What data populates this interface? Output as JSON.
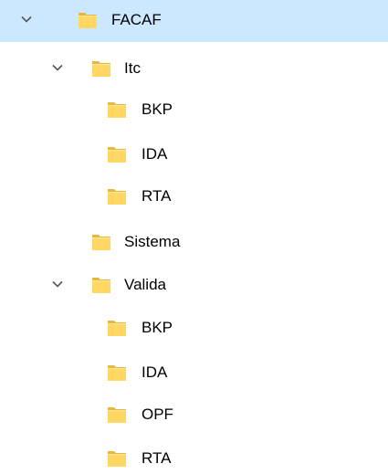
{
  "tree": {
    "nodes": [
      {
        "label": "FACAF",
        "level": 0,
        "expanded": true,
        "selected": true
      },
      {
        "label": "Itc",
        "level": 1,
        "expanded": true,
        "selected": false
      },
      {
        "label": "BKP",
        "level": 2,
        "expanded": null,
        "selected": false
      },
      {
        "label": "IDA",
        "level": 2,
        "expanded": null,
        "selected": false
      },
      {
        "label": "RTA",
        "level": 2,
        "expanded": null,
        "selected": false
      },
      {
        "label": "Sistema",
        "level": 1,
        "expanded": null,
        "selected": false
      },
      {
        "label": "Valida",
        "level": 1,
        "expanded": true,
        "selected": false
      },
      {
        "label": "BKP",
        "level": 2,
        "expanded": null,
        "selected": false
      },
      {
        "label": "IDA",
        "level": 2,
        "expanded": null,
        "selected": false
      },
      {
        "label": "OPF",
        "level": 2,
        "expanded": null,
        "selected": false
      },
      {
        "label": "RTA",
        "level": 2,
        "expanded": null,
        "selected": false
      }
    ]
  },
  "colors": {
    "selection": "#cce8ff",
    "folder_body": "#ffd762",
    "folder_back": "#e8b838",
    "chevron": "#555555",
    "text": "#000000"
  },
  "icons": {
    "folder": "folder-icon",
    "expand": "chevron-down-icon"
  }
}
